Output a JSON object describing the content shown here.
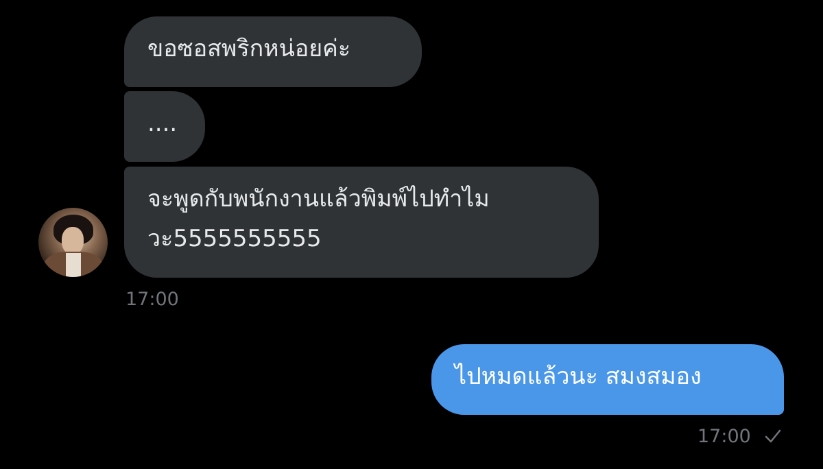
{
  "messages": {
    "incoming": [
      {
        "text": "ขอซอสพริกหน่อยค่ะ"
      },
      {
        "text": "...."
      },
      {
        "lines": [
          "จะพูดกับพนักงานแล้วพิมพ์ไปทำไม",
          "วะ5555555555"
        ]
      }
    ],
    "incoming_time": "17:00",
    "outgoing": [
      {
        "text": "ไปหมดแล้วนะ สมงสมอง"
      }
    ],
    "outgoing_time": "17:00"
  },
  "icons": {
    "avatar": "profile-photo",
    "status": "checkmark-icon"
  },
  "colors": {
    "background": "#000000",
    "incoming_bubble": "#2f3336",
    "outgoing_bubble": "#4a97ea",
    "timestamp": "#71767b"
  }
}
